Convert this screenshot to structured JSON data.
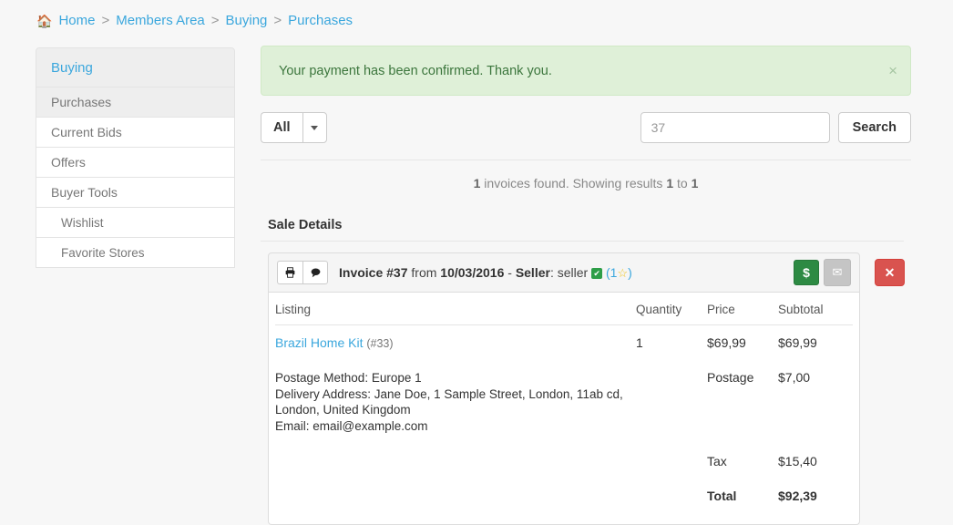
{
  "breadcrumb": {
    "home_icon": "home-icon",
    "items": [
      {
        "label": "Home"
      },
      {
        "label": "Members Area"
      },
      {
        "label": "Buying"
      },
      {
        "label": "Purchases"
      }
    ],
    "separator": ">"
  },
  "sidebar": {
    "header": "Buying",
    "items": [
      {
        "label": "Purchases",
        "active": true,
        "sub": false
      },
      {
        "label": "Current Bids",
        "active": false,
        "sub": false
      },
      {
        "label": "Offers",
        "active": false,
        "sub": false
      },
      {
        "label": "Buyer Tools",
        "active": false,
        "sub": false
      },
      {
        "label": "Wishlist",
        "active": false,
        "sub": true
      },
      {
        "label": "Favorite Stores",
        "active": false,
        "sub": true
      }
    ]
  },
  "alert": {
    "message": "Your payment has been confirmed. Thank you.",
    "close_label": "×",
    "bg_color": "#dff0d8",
    "text_color": "#3c763d"
  },
  "toolbar": {
    "filter_label": "All",
    "search_placeholder": "37",
    "search_value": "",
    "search_button": "Search"
  },
  "results": {
    "count": "1",
    "text_middle": " invoices found. Showing results ",
    "from": "1",
    "text_to": " to ",
    "to": "1"
  },
  "sale_details": {
    "title": "Sale Details"
  },
  "invoice": {
    "print_icon": "print-icon",
    "comment_icon": "comment-icon",
    "title_prefix": "Invoice #37",
    "from_label": " from ",
    "date": "10/03/2016",
    "seller_sep": " - ",
    "seller_label": "Seller",
    "seller_colon": ": ",
    "seller_name": "seller",
    "verified_icon": "✔",
    "rating_open": "(",
    "rating_count": "1",
    "rating_star": "☆",
    "rating_close": ")",
    "pay_button": "$",
    "mail_icon": "✉",
    "delete_button": "✕",
    "pay_color": "#2d8a43",
    "delete_color": "#d9534f",
    "columns": [
      "Listing",
      "Quantity",
      "Price",
      "Subtotal"
    ],
    "line_item": {
      "name": "Brazil Home Kit",
      "id": "(#33)",
      "quantity": "1",
      "price": "$69,99",
      "subtotal": "$69,99"
    },
    "shipping": {
      "postage_method": "Postage Method: Europe 1",
      "delivery_address": "Delivery Address: Jane Doe, 1 Sample Street, London, 11ab cd, London, United Kingdom",
      "email": "Email: email@example.com",
      "postage_label": "Postage",
      "postage_value": "$7,00"
    },
    "tax_label": "Tax",
    "tax_value": "$15,40",
    "total_label": "Total",
    "total_value": "$92,39"
  }
}
